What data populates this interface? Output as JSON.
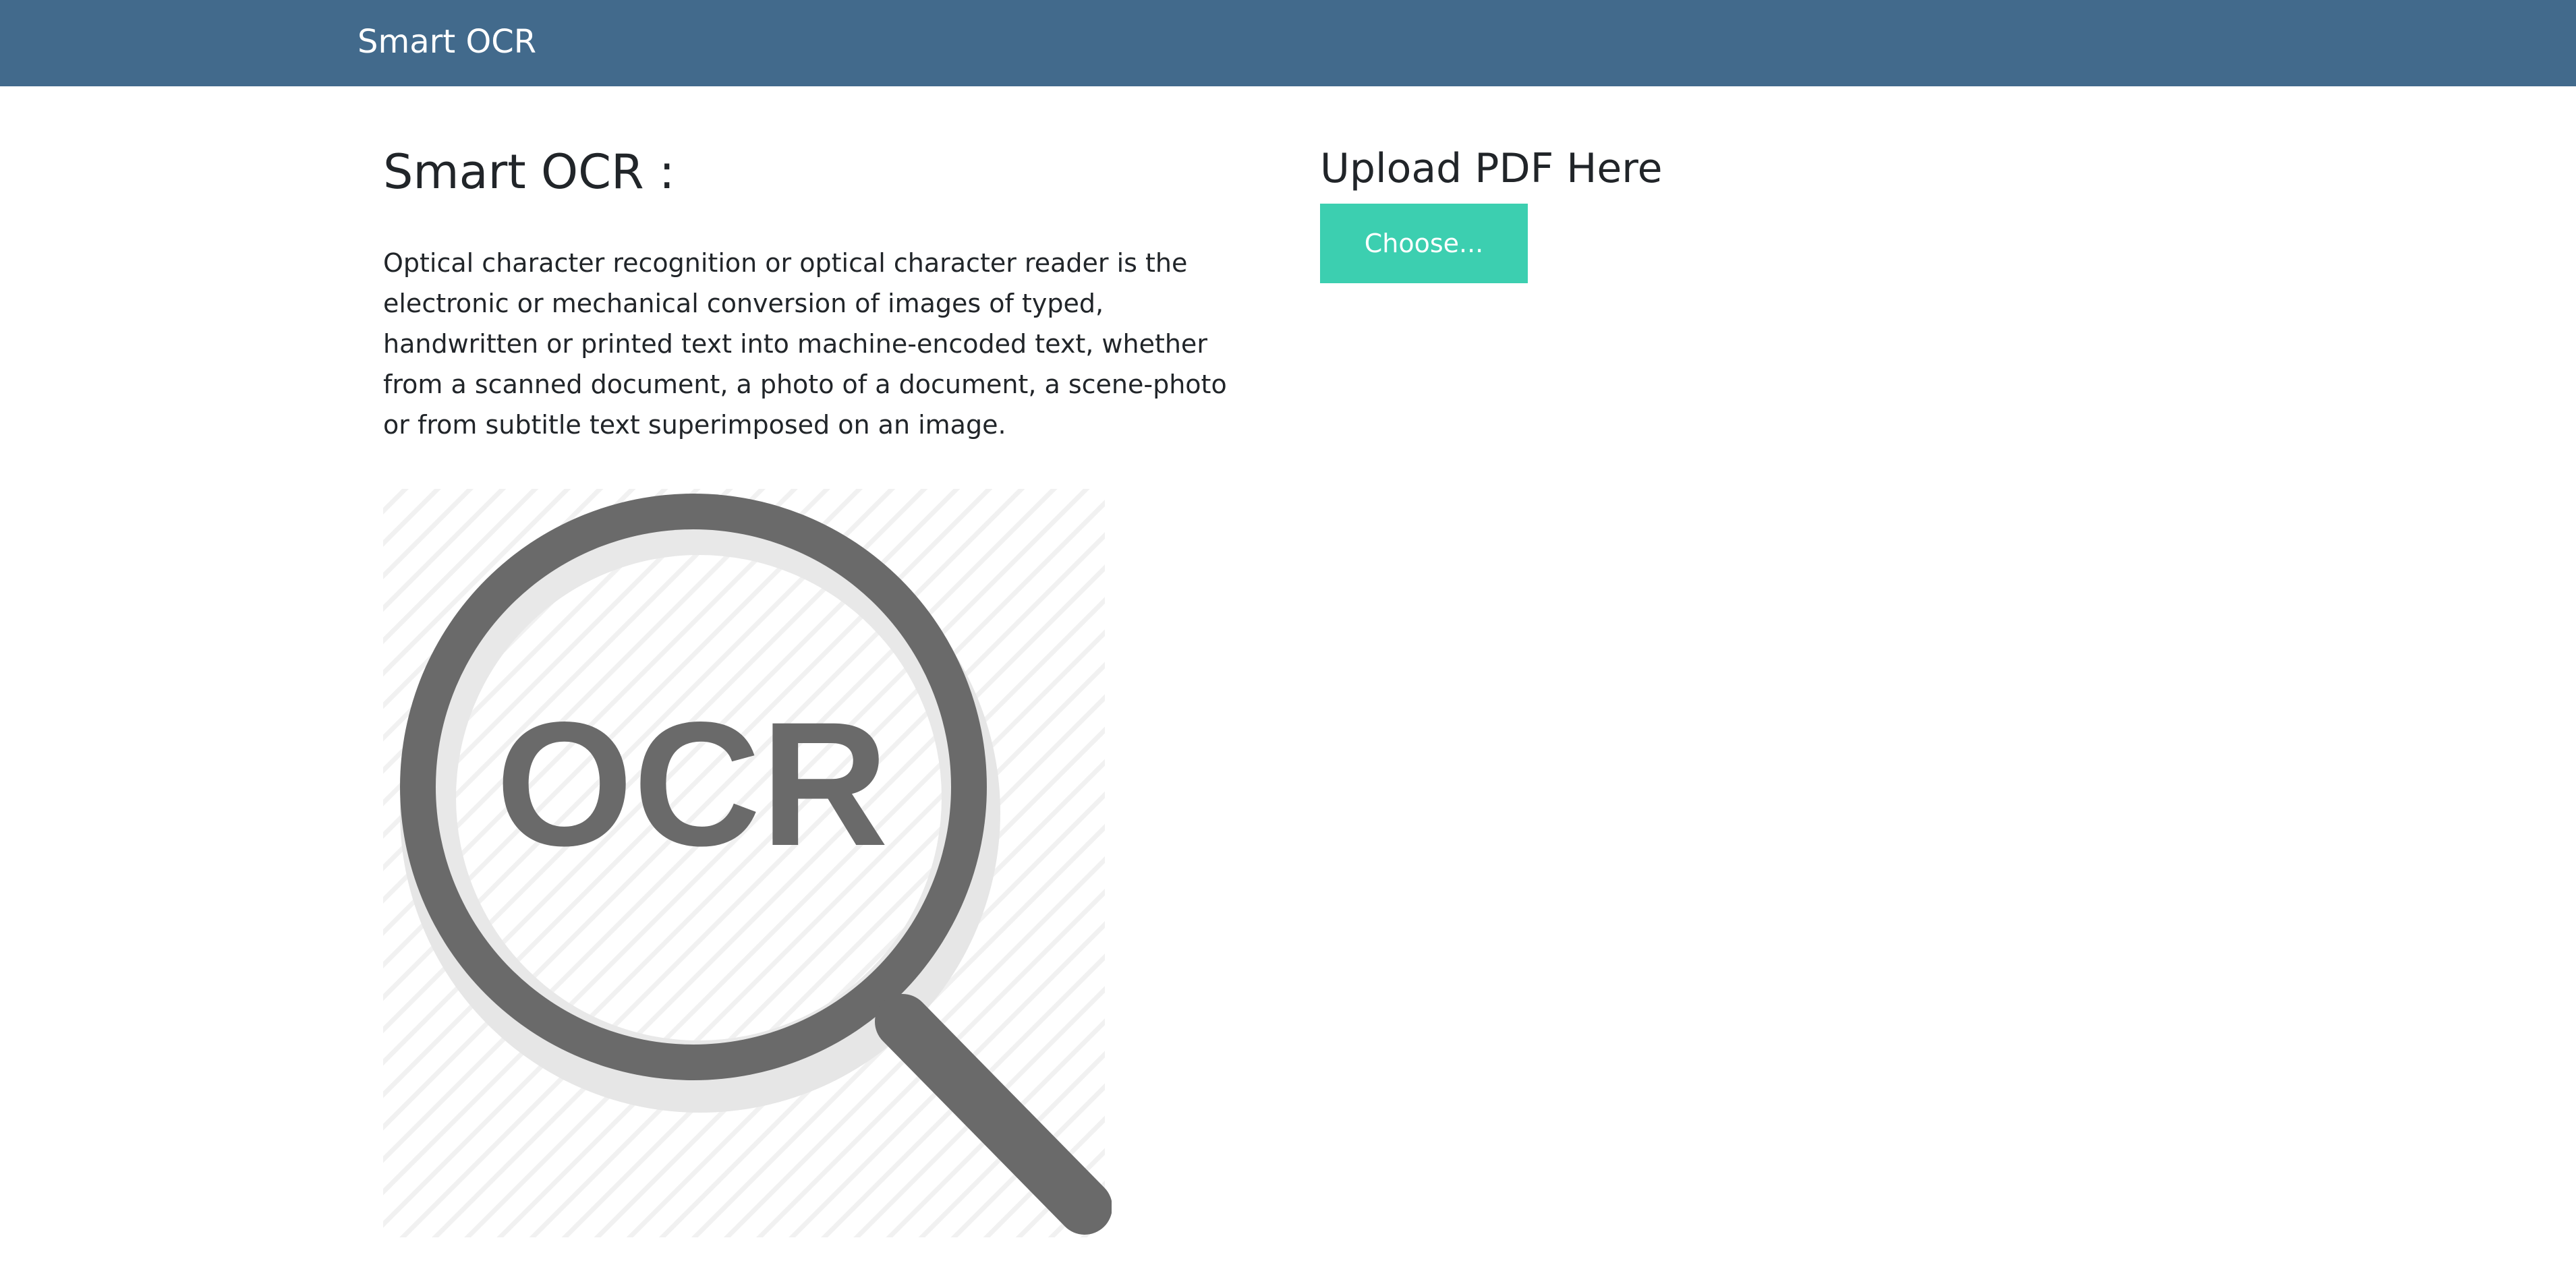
{
  "navbar": {
    "brand": "Smart OCR",
    "background_color": "#426a8c"
  },
  "intro": {
    "title": "Smart OCR :",
    "description": "Optical character recognition or optical character reader is the electronic or mechanical conversion of images of typed, handwritten or printed text into machine-encoded text, whether from a scanned document, a photo of a document, a scene-photo or from subtitle text superimposed on an image.",
    "illustration": {
      "icon": "magnifying-glass-icon",
      "text": "OCR",
      "color": "#6a6a6a"
    }
  },
  "upload": {
    "title": "Upload PDF Here",
    "choose_label": "Choose...",
    "button_color": "#3ccfb0"
  }
}
